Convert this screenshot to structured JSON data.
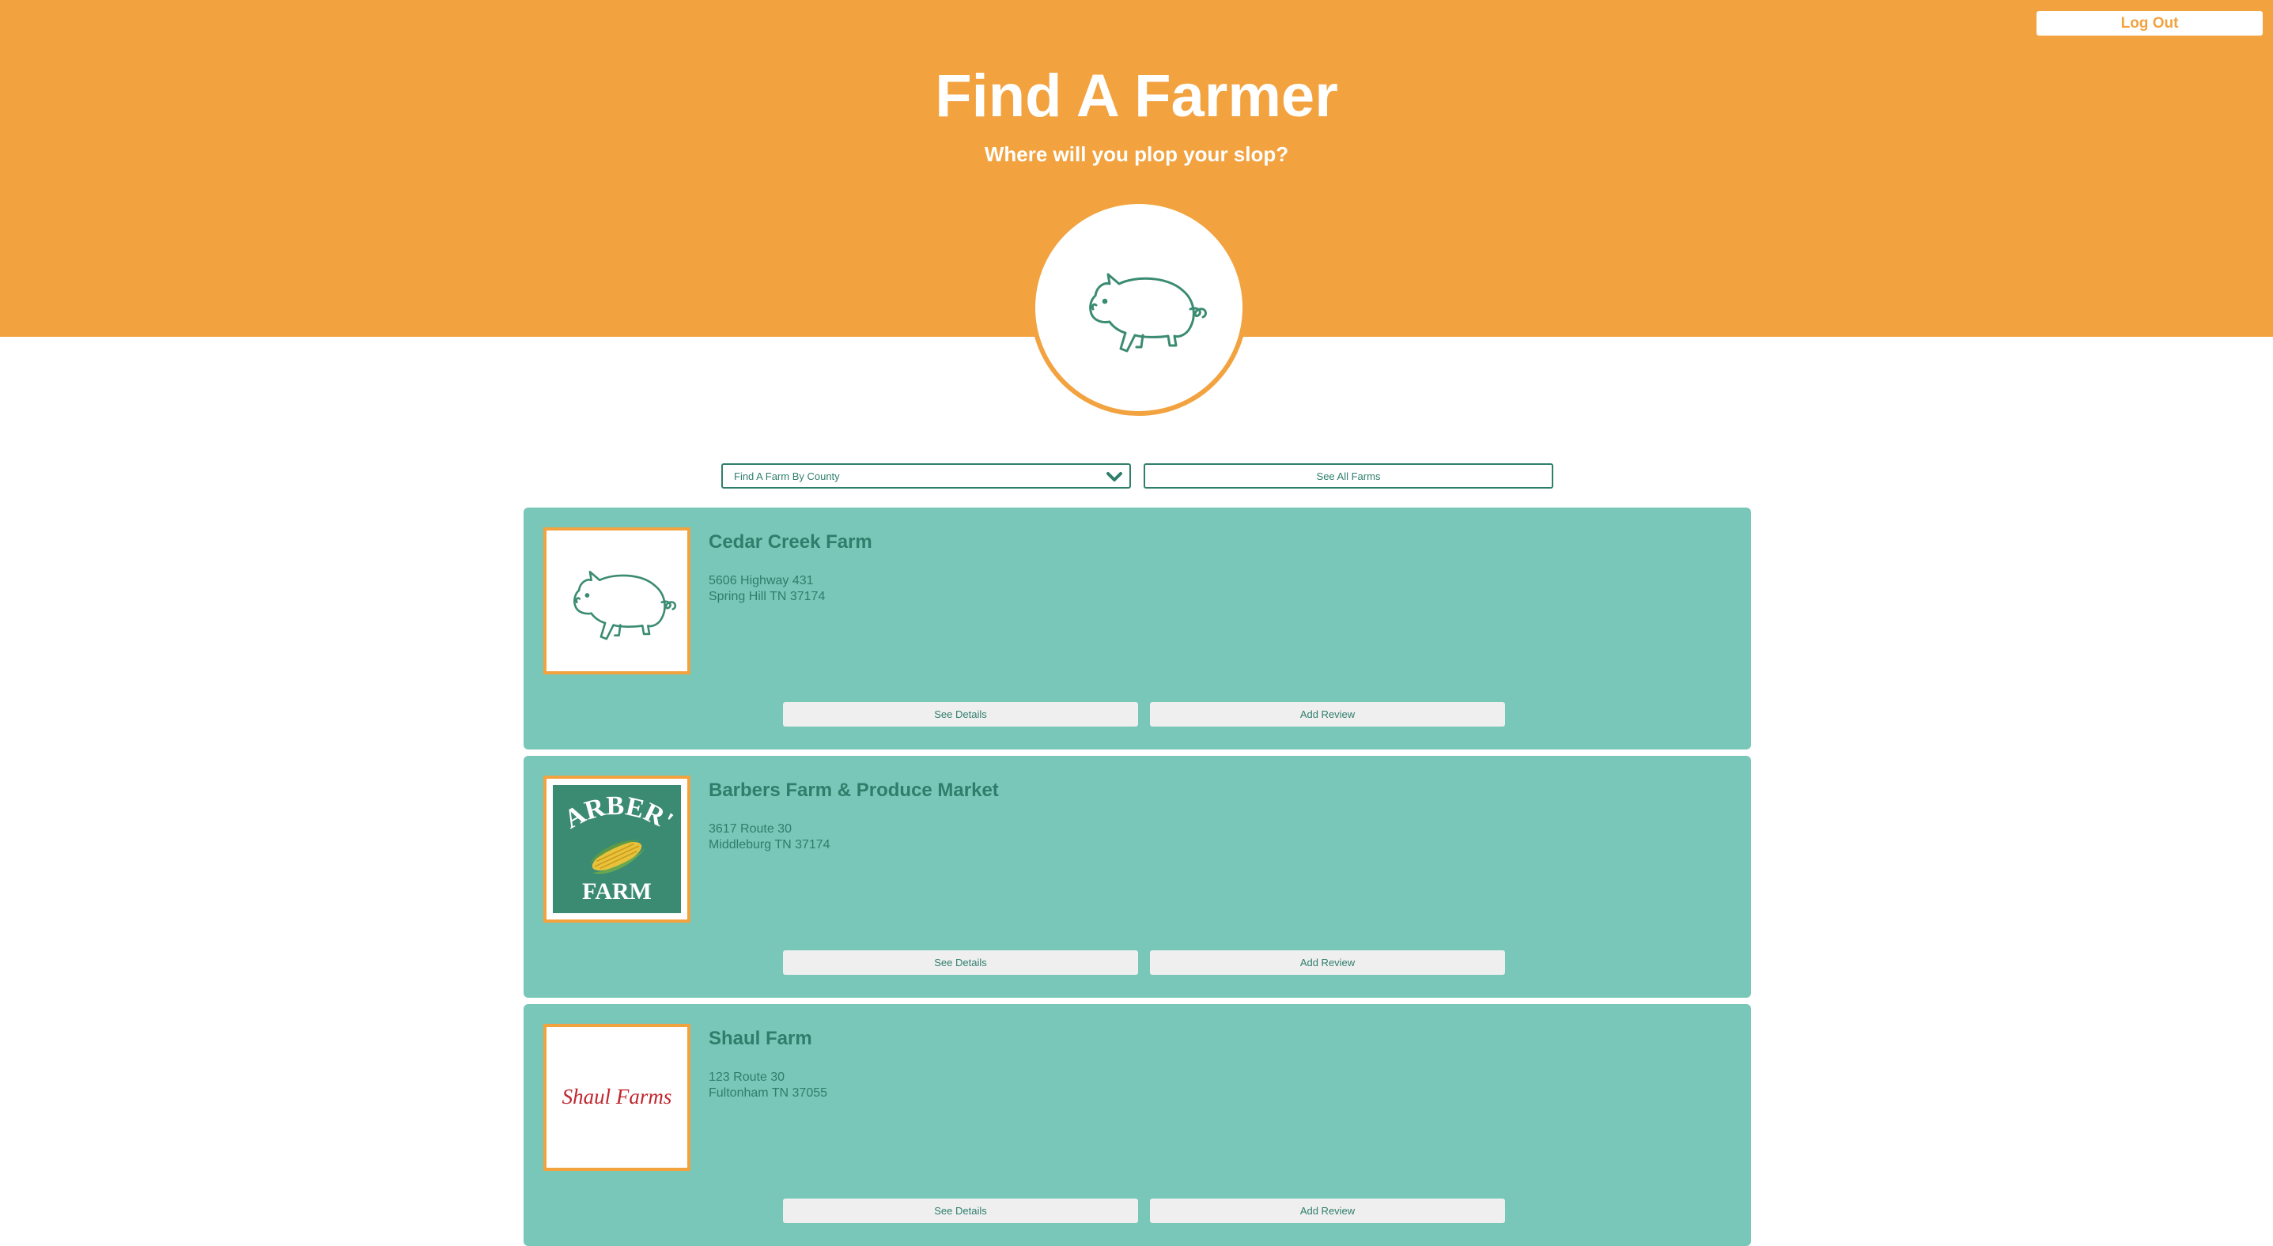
{
  "header": {
    "logout_label": "Log Out",
    "title": "Find A Farmer",
    "subtitle": "Where will you plop your slop?",
    "logo_icon": "pig-icon"
  },
  "filters": {
    "county_select_label": "Find A Farm By County",
    "see_all_label": "See All Farms"
  },
  "farms": [
    {
      "name": "Cedar Creek Farm",
      "address_line1": "5606 Highway 431",
      "address_line2": "Spring Hill TN 37174",
      "image": "pig-icon",
      "details_label": "See Details",
      "review_label": "Add Review"
    },
    {
      "name": "Barbers Farm & Produce Market",
      "address_line1": "3617 Route 30",
      "address_line2": "Middleburg TN 37174",
      "image": "barbers-farm-logo",
      "logo_text_top": "BARBER'S",
      "logo_text_bottom": "FARM",
      "details_label": "See Details",
      "review_label": "Add Review"
    },
    {
      "name": "Shaul Farm",
      "address_line1": "123 Route 30",
      "address_line2": "Fultonham TN 37055",
      "image": "shaul-farms-logo",
      "logo_text": "Shaul Farms",
      "details_label": "See Details",
      "review_label": "Add Review"
    }
  ],
  "colors": {
    "header_orange": "#f2a340",
    "card_teal": "#79c7b8",
    "text_dark_teal": "#2f7e6c",
    "button_gray": "#efefef",
    "barbers_green": "#3b8b72",
    "shaul_red": "#c0262d"
  }
}
